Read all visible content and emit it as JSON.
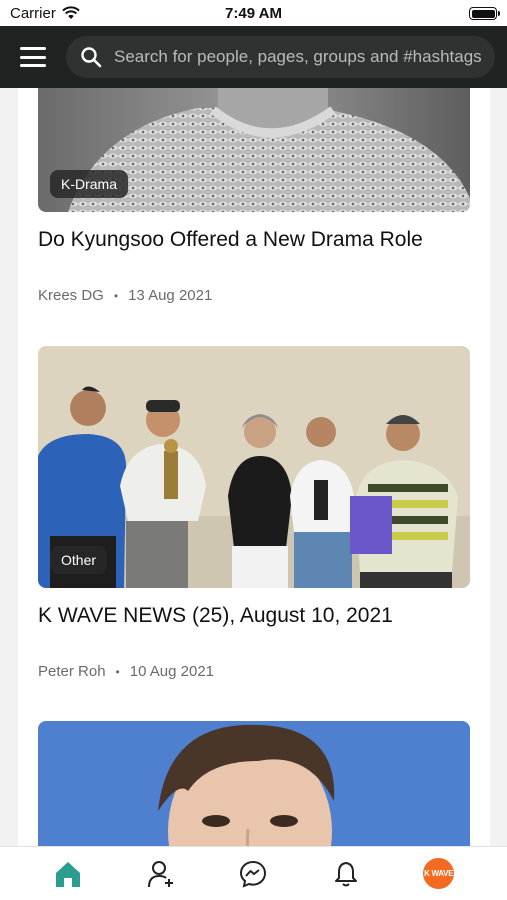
{
  "status_bar": {
    "carrier": "Carrier",
    "time": "7:49 AM"
  },
  "search": {
    "placeholder": "Search for people, pages, groups and #hashtags"
  },
  "posts": [
    {
      "category": "K-Drama",
      "title": "Do Kyungsoo Offered a New Drama Role",
      "author": "Krees DG",
      "date": "13 Aug 2021"
    },
    {
      "category": "Other",
      "title": "K WAVE NEWS (25), August 10, 2021",
      "author": "Peter Roh",
      "date": "10 Aug 2021"
    }
  ],
  "nav": {
    "profile_label": "K WAVE"
  },
  "colors": {
    "accent": "#2a9d8f",
    "brand": "#f36a21",
    "top_bar": "#1f2321"
  }
}
